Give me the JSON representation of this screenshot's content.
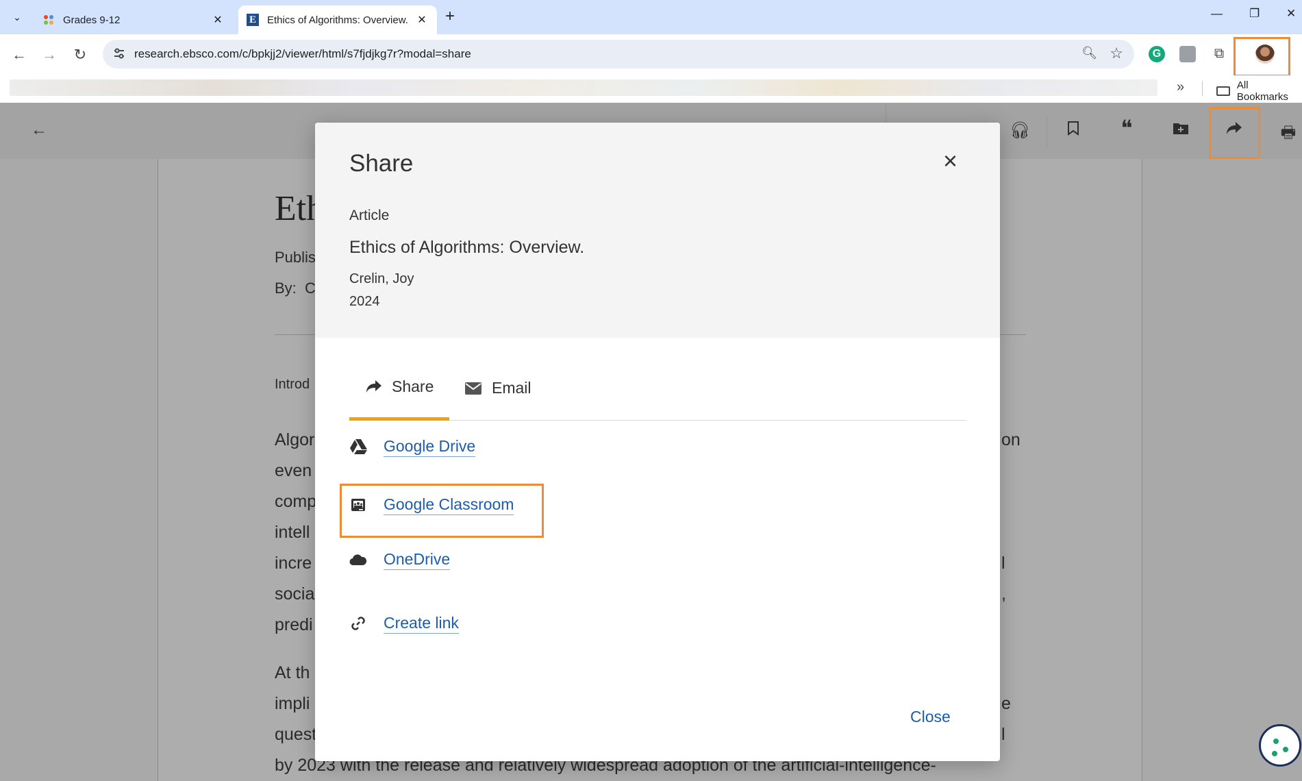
{
  "browser": {
    "tabs": [
      {
        "title": "Grades 9-12",
        "active": false
      },
      {
        "title": "Ethics of Algorithms: Overview.",
        "active": true
      }
    ],
    "url": "research.ebsco.com/c/bpkjj2/viewer/html/s7fjdjkg7r?modal=share",
    "bookmarks": {
      "all_label": "All Bookmarks",
      "more": "»"
    }
  },
  "page": {
    "title_fragment": "Eth",
    "published_fragment": "Publis",
    "by_label": "By:",
    "by_fragment": "C",
    "intro_fragment": "Introd",
    "paragraph1_lines": [
      "Algor",
      "even",
      "comp",
      "intell",
      "incre",
      "socia",
      "predi"
    ],
    "paragraph1_right": [
      "on",
      "",
      "",
      "",
      "l",
      ",",
      ""
    ],
    "paragraph2_lines": [
      "At th",
      "impli",
      "quest"
    ],
    "paragraph2_right": [
      "e",
      "",
      "l"
    ],
    "last_line": "by 2023 with the release and relatively widespread adoption of the artificial-intelligence-"
  },
  "modal": {
    "title": "Share",
    "close_x": "×",
    "item_type": "Article",
    "article_title": "Ethics of Algorithms: Overview.",
    "author": "Crelin, Joy",
    "year": "2024",
    "tabs": [
      {
        "label": "Share",
        "icon": "share-arrow-icon",
        "active": true
      },
      {
        "label": "Email",
        "icon": "envelope-icon",
        "active": false
      }
    ],
    "share_options": [
      {
        "label": "Google Drive",
        "icon": "google-drive-icon"
      },
      {
        "label": "Google Classroom",
        "icon": "google-classroom-icon",
        "highlighted": true
      },
      {
        "label": "OneDrive",
        "icon": "cloud-icon"
      },
      {
        "label": "Create link",
        "icon": "link-icon"
      }
    ],
    "close_label": "Close"
  },
  "colors": {
    "accent_tab": "#f0a30a",
    "link": "#1c5ca8",
    "highlight_box": "#ed8c37",
    "overlay": "#a9a9a9"
  }
}
